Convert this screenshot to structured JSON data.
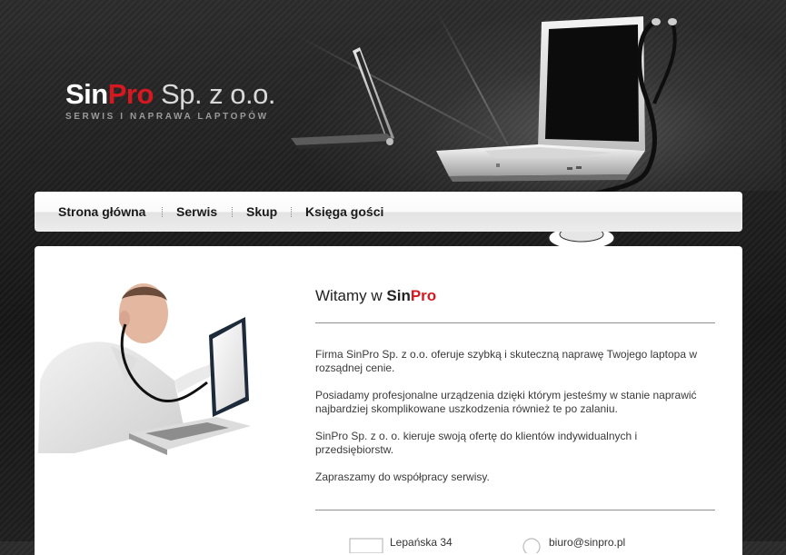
{
  "logo": {
    "name_part1": "Sin",
    "name_part2": "Pro",
    "name_suffix": " Sp. z o.o.",
    "tagline": "SERWIS I NAPRAWA LAPTOPÓW"
  },
  "nav": {
    "items": [
      {
        "label": "Strona główna"
      },
      {
        "label": "Serwis"
      },
      {
        "label": "Skup"
      },
      {
        "label": "Księga gości"
      }
    ]
  },
  "main": {
    "heading_prefix": "Witamy w ",
    "heading_sin": "Sin",
    "heading_pro": "Pro",
    "paragraphs": [
      "Firma SinPro Sp. z o.o. oferuje szybką i skuteczną naprawę Twojego laptopa w rozsądnej cenie.",
      "Posiadamy profesjonalne urządzenia dzięki którym jesteśmy w stanie naprawić najbardziej skomplikowane uszkodzenia również te po zalaniu.",
      "SinPro Sp. z o. o. kieruje swoją ofertę do klientów indywidualnych i przedsiębiorstw.",
      "Zapraszamy do współpracy serwisy."
    ]
  },
  "contact": {
    "address": "Lepańska 34",
    "email": "biuro@sinpro.pl"
  },
  "colors": {
    "brand_red": "#d61921",
    "background_dark": "#1c1c1c",
    "panel_white": "#ffffff"
  },
  "icons": {
    "address": "map-pin-icon",
    "email": "envelope-icon"
  }
}
